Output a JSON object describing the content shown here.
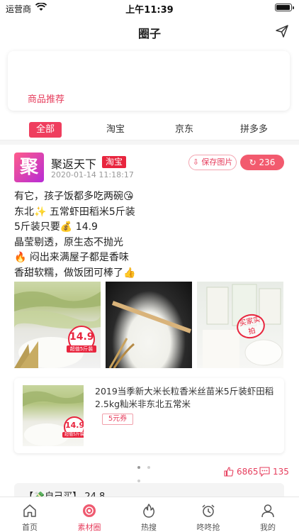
{
  "status_bar": {
    "carrier": "运营商",
    "time": "上午11:39"
  },
  "nav": {
    "title": "圈子"
  },
  "banner": {
    "label": "商品推荐"
  },
  "tabs": [
    {
      "label": "全部",
      "active": true
    },
    {
      "label": "淘宝"
    },
    {
      "label": "京东"
    },
    {
      "label": "拼多多"
    }
  ],
  "post": {
    "avatar_char": "聚",
    "user": "聚返天下",
    "platform": "淘宝",
    "time": "2020-01-14 11:18:17",
    "save_label": "保存图片",
    "share_count": "236",
    "lines": [
      "有它，孩子饭都多吃两碗😘",
      "东北✨ 五常虾田稻米5斤装",
      "5斤装只要💰 14.9",
      "晶莹剔透，原生态不抛光",
      "🔥 闷出来满屋子都是香味",
      "香甜软糯，做饭团可棒了👍"
    ],
    "image_price": "14.9",
    "image_price_sub": "超值5斤装",
    "stamp_text": "买家实拍",
    "product": {
      "title": "2019当季新大米长粒香米丝苗米5斤装虾田稻2.5kg籼米非东北五常米",
      "coupon": "5元券",
      "thumb_price": "14.9",
      "thumb_price_sub": "超值5斤装"
    },
    "likes": "6865",
    "comments": "135",
    "comment_preview": "【💸自己买】 24.8"
  },
  "tabbar": [
    {
      "label": "首页",
      "icon": "home-icon"
    },
    {
      "label": "素材圈",
      "icon": "circle-icon",
      "active": true
    },
    {
      "label": "热搜",
      "icon": "fire-icon"
    },
    {
      "label": "咚咚抢",
      "icon": "alarm-clock-icon"
    },
    {
      "label": "我的",
      "icon": "user-icon"
    }
  ],
  "colors": {
    "accent": "#e63d5c",
    "tag_red": "#e8253e"
  }
}
